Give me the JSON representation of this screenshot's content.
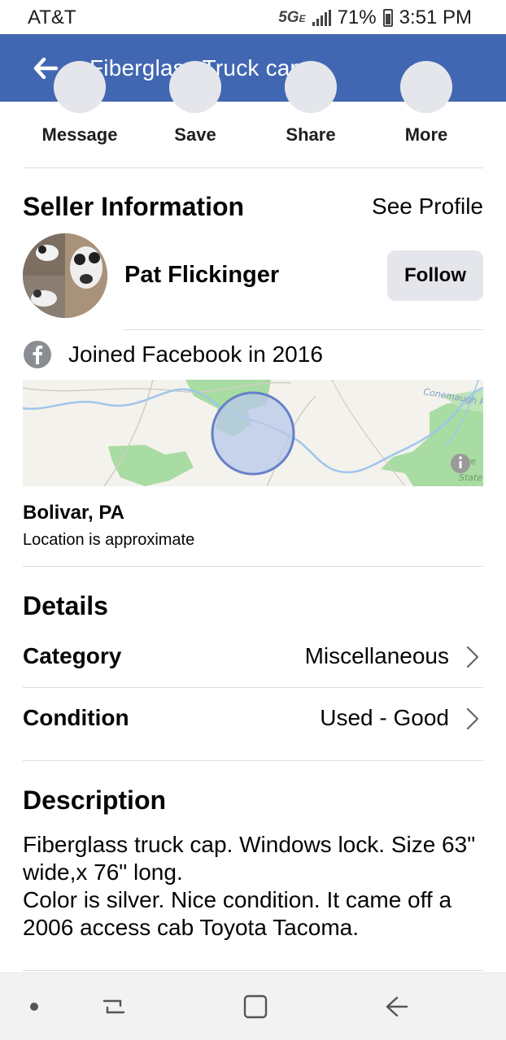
{
  "status_bar": {
    "carrier": "AT&T",
    "network": "5G",
    "network_sub": "E",
    "battery": "71%",
    "time": "3:51 PM"
  },
  "header": {
    "title": "Fiberglass Truck cap",
    "back_icon": "arrow-left-icon",
    "background": "#4267b2"
  },
  "actions": [
    {
      "label": "Message"
    },
    {
      "label": "Save"
    },
    {
      "label": "Share"
    },
    {
      "label": "More"
    }
  ],
  "seller": {
    "section_title": "Seller Information",
    "see_profile": "See Profile",
    "name": "Pat Flickinger",
    "follow_label": "Follow",
    "joined": "Joined Facebook in 2016",
    "joined_icon": "facebook-icon"
  },
  "map": {
    "river_label": "Conemaugh Ri",
    "park_label_1": "re",
    "park_label_2": "State",
    "info_icon": "info-icon"
  },
  "location": {
    "name": "Bolivar, PA",
    "note": "Location is approximate"
  },
  "details": {
    "section_title": "Details",
    "rows": [
      {
        "label": "Category",
        "value": "Miscellaneous"
      },
      {
        "label": "Condition",
        "value": "Used - Good"
      }
    ]
  },
  "description": {
    "section_title": "Description",
    "text": "Fiberglass truck cap.  Windows lock.  Size 63\" wide,x 76\" long.\nColor is silver.  Nice condition.  It came off a 2006 access cab Toyota Tacoma."
  },
  "nav_bar": {
    "items": [
      "dot-icon",
      "recent-apps-icon",
      "home-icon",
      "back-icon"
    ]
  }
}
